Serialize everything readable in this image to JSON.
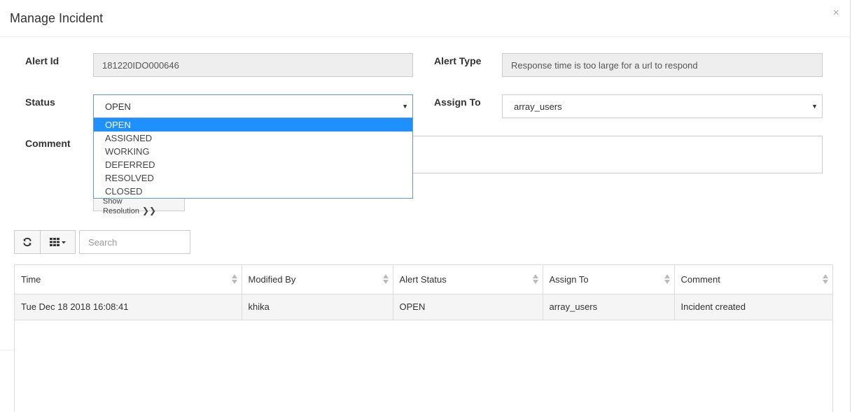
{
  "modal": {
    "title": "Manage Incident",
    "close_label": "×"
  },
  "form": {
    "alert_id": {
      "label": "Alert Id",
      "value": "181220IDO000646"
    },
    "alert_type": {
      "label": "Alert Type",
      "value": "Response time is too large for a url to respond"
    },
    "status": {
      "label": "Status",
      "selected": "OPEN",
      "options": [
        "OPEN",
        "ASSIGNED",
        "WORKING",
        "DEFERRED",
        "RESOLVED",
        "CLOSED"
      ]
    },
    "assign_to": {
      "label": "Assign To",
      "selected": "array_users"
    },
    "comment": {
      "label": "Comment",
      "value": ""
    },
    "show_resolution_label": "Show Resolution",
    "show_resolution_chevron": "❯❯"
  },
  "toolbar": {
    "refresh_icon": "refresh-icon",
    "columns_icon": "columns-grid-icon",
    "search_placeholder": "Search"
  },
  "table": {
    "columns": [
      "Time",
      "Modified By",
      "Alert Status",
      "Assign To",
      "Comment"
    ],
    "rows": [
      [
        "Tue Dec 18 2018 16:08:41",
        "khika",
        "OPEN",
        "array_users",
        "Incident created"
      ]
    ]
  }
}
